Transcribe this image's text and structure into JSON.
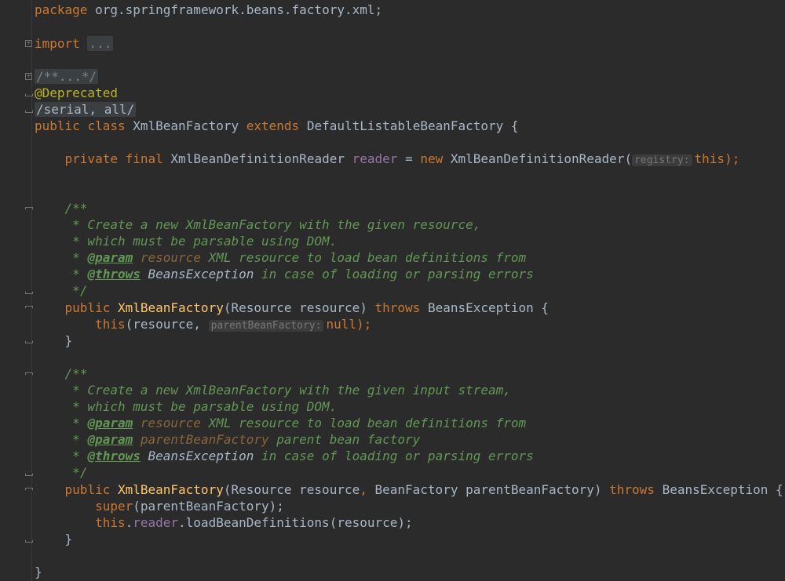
{
  "editor": {
    "language": "java",
    "theme_colors": {
      "background": "#2b2b2b",
      "keyword": "#cc7832",
      "annotation": "#bbb529",
      "field": "#9876aa",
      "method": "#ffc66d",
      "doc_comment": "#629755",
      "default_text": "#a9b7c6"
    },
    "lines": {
      "package": {
        "kw": "package",
        "name": "org.springframework.beans.factory.xml;"
      },
      "imports": {
        "kw": "import",
        "folded": "..."
      },
      "doc_folded": "/**...*/",
      "annotation": "@Deprecated",
      "suppress": "/serial, all/",
      "class_decl": {
        "kw1": "public",
        "kw2": "class",
        "name": "XmlBeanFactory",
        "kw3": "extends",
        "parent": "DefaultListableBeanFactory",
        "brace": "{"
      },
      "field_decl": {
        "kw1": "private",
        "kw2": "final",
        "type": "XmlBeanDefinitionReader",
        "name": "reader",
        "eq": "=",
        "kw3": "new",
        "ctor": "XmlBeanDefinitionReader(",
        "hint": "registry:",
        "arg": "this",
        "end": ");"
      },
      "doc1": {
        "open": "/**",
        "l1": " * Create a new XmlBeanFactory with the given resource,",
        "l2": " * which must be parsable using DOM.",
        "l3_star": " * ",
        "l3_tag": "@param",
        "l3_param": "resource",
        "l3_text": " XML resource to load bean definitions from",
        "l4_star": " * ",
        "l4_tag": "@throws",
        "l4_ref": "BeansException",
        "l4_text": " in case of loading or parsing errors",
        "close": " */"
      },
      "ctor1": {
        "kw": "public",
        "name": "XmlBeanFactory",
        "params": "(Resource resource)",
        "kw2": "throws",
        "exc": "BeansException {",
        "body_kw": "this",
        "body_a": "(resource,",
        "hint": "parentBeanFactory:",
        "body_null": "null",
        "body_end": ");",
        "close": "}"
      },
      "doc2": {
        "open": "/**",
        "l1": " * Create a new XmlBeanFactory with the given input stream,",
        "l2": " * which must be parsable using DOM.",
        "l3_star": " * ",
        "l3_tag": "@param",
        "l3_param": "resource",
        "l3_text": " XML resource to load bean definitions from",
        "l4_star": " * ",
        "l4_tag": "@param",
        "l4_param": "parentBeanFactory",
        "l4_text": " parent bean factory",
        "l5_star": " * ",
        "l5_tag": "@throws",
        "l5_ref": "BeansException",
        "l5_text": " in case of loading or parsing errors",
        "close": " */"
      },
      "ctor2": {
        "kw": "public",
        "name": "XmlBeanFactory",
        "params_a": "(Resource resource",
        "comma": ",",
        "params_b": " BeanFactory parentBeanFactory)",
        "kw2": "throws",
        "exc": "BeansException {",
        "super_kw": "super",
        "super_args": "(parentBeanFactory);",
        "this_kw": "this",
        "dot": ".",
        "field": "reader",
        "call": ".loadBeanDefinitions(resource);",
        "close": "}"
      },
      "class_close": "}"
    }
  }
}
